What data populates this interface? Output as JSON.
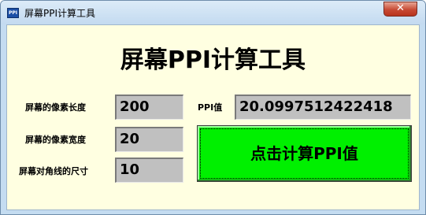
{
  "window": {
    "title": "屏幕PPI计算工具",
    "icon": "app-ppi-icon",
    "icon_text": "PPI",
    "close_glyph": "✕"
  },
  "main": {
    "heading": "屏幕PPI计算工具",
    "fields": [
      {
        "label": "屏幕的像素长度",
        "value": "200"
      },
      {
        "label": "屏幕的像素宽度",
        "value": "20"
      },
      {
        "label": "屏幕对角线的尺寸",
        "value": "10"
      }
    ],
    "result": {
      "label": "PPI值",
      "value": "20.0997512422418"
    },
    "calc_button_label": "点击计算PPI值"
  },
  "colors": {
    "client_background": "#ffffe1",
    "field_background": "#c0c0c0",
    "button_green": "#00f000",
    "titlebar": "#c4dcf1",
    "close_red": "#c74a34"
  }
}
